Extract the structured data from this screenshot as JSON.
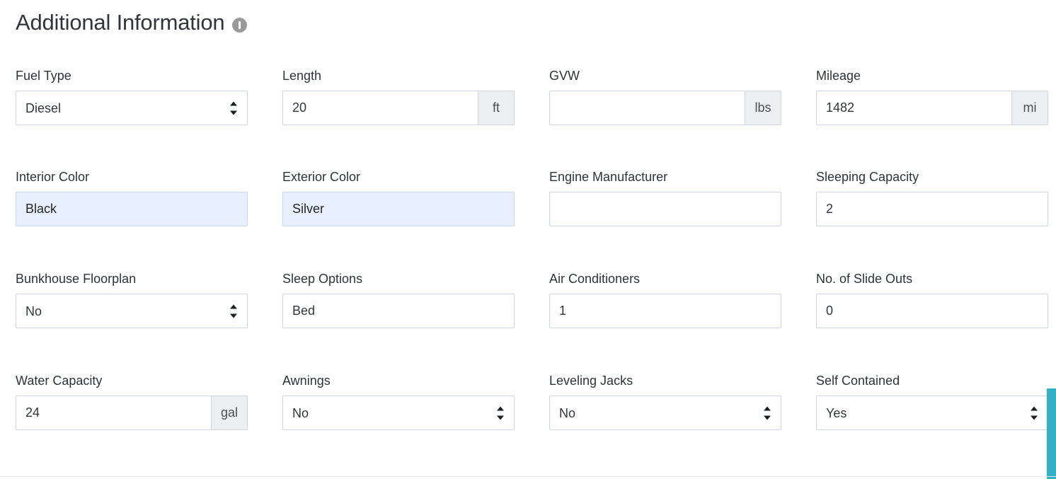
{
  "header": {
    "title": "Additional Information",
    "info_icon": "info-icon"
  },
  "theme": {
    "accent": "#31b0c6",
    "autofill_bg": "#e8f0fe",
    "addon_bg": "#eceff1",
    "border": "#ced4da",
    "label_color": "#2e3338"
  },
  "form": {
    "rows": [
      {
        "fields": [
          {
            "label": "Fuel Type",
            "kind": "select",
            "value": "Diesel",
            "unit": ""
          },
          {
            "label": "Length",
            "kind": "input",
            "value": "20",
            "unit": "ft"
          },
          {
            "label": "GVW",
            "kind": "input",
            "value": "",
            "unit": "lbs"
          },
          {
            "label": "Mileage",
            "kind": "input",
            "value": "1482",
            "unit": "mi"
          }
        ]
      },
      {
        "fields": [
          {
            "label": "Interior Color",
            "kind": "input",
            "value": "Black",
            "unit": "",
            "autofill": true
          },
          {
            "label": "Exterior Color",
            "kind": "input",
            "value": "Silver",
            "unit": "",
            "autofill": true
          },
          {
            "label": "Engine Manufacturer",
            "kind": "input",
            "value": "",
            "unit": ""
          },
          {
            "label": "Sleeping Capacity",
            "kind": "input",
            "value": "2",
            "unit": ""
          }
        ]
      },
      {
        "fields": [
          {
            "label": "Bunkhouse Floorplan",
            "kind": "select",
            "value": "No",
            "unit": ""
          },
          {
            "label": "Sleep Options",
            "kind": "input",
            "value": "Bed",
            "unit": ""
          },
          {
            "label": "Air Conditioners",
            "kind": "input",
            "value": "1",
            "unit": ""
          },
          {
            "label": "No. of Slide Outs",
            "kind": "input",
            "value": "0",
            "unit": ""
          }
        ]
      },
      {
        "fields": [
          {
            "label": "Water Capacity",
            "kind": "input",
            "value": "24",
            "unit": "gal"
          },
          {
            "label": "Awnings",
            "kind": "select",
            "value": "No",
            "unit": ""
          },
          {
            "label": "Leveling Jacks",
            "kind": "select",
            "value": "No",
            "unit": ""
          },
          {
            "label": "Self Contained",
            "kind": "select",
            "value": "Yes",
            "unit": ""
          }
        ]
      }
    ]
  }
}
